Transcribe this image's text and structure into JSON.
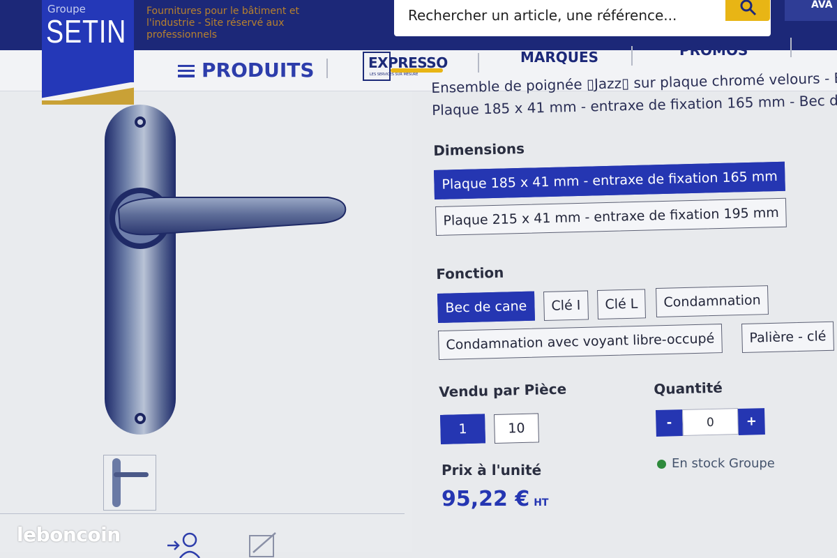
{
  "brand": {
    "group_label": "Groupe",
    "name": "SETIN",
    "tagline": "Fournitures pour le bâtiment et l'industrie - Site réservé aux professionnels"
  },
  "search": {
    "placeholder": "Rechercher un article, une référence...",
    "icon": "magnifier-icon"
  },
  "corner_link": "AVA",
  "nav": {
    "produits": "PRODUITS",
    "expresso": "EXPRESSO",
    "expresso_sub": "LES SERVICES SUR MESURE",
    "marques": "MARQUES",
    "promos": "PROMOS"
  },
  "product": {
    "description_line1": "Ensemble de poignée ▯Jazz▯ sur plaque chromé velours - B",
    "description_line2": "Plaque 185 x 41 mm - entraxe de fixation 165 mm - Bec de"
  },
  "dimensions": {
    "label": "Dimensions",
    "options": [
      {
        "label": "Plaque 185 x 41 mm - entraxe de fixation 165 mm",
        "selected": true
      },
      {
        "label": "Plaque 215 x 41 mm - entraxe de fixation 195 mm",
        "selected": false
      }
    ]
  },
  "fonction": {
    "label": "Fonction",
    "options": [
      {
        "label": "Bec de cane",
        "selected": true
      },
      {
        "label": "Clé I",
        "selected": false
      },
      {
        "label": "Clé L",
        "selected": false
      },
      {
        "label": "Condamnation",
        "selected": false
      },
      {
        "label": "Condamnation avec voyant libre-occupé",
        "selected": false
      },
      {
        "label": "Palière - clé",
        "selected": false
      }
    ]
  },
  "vendu": {
    "label": "Vendu par Pièce",
    "options": [
      {
        "label": "1",
        "selected": true
      },
      {
        "label": "10",
        "selected": false
      }
    ]
  },
  "quantite": {
    "label": "Quantité",
    "minus": "-",
    "value": "0",
    "plus": "+"
  },
  "stock": {
    "text": "En stock Groupe",
    "status_color": "#2e8a3c"
  },
  "prix": {
    "label": "Prix à l'unité",
    "value": "95,22 €",
    "suffix": "HT"
  },
  "watermark": "leboncoin",
  "colors": {
    "primary": "#2536b2",
    "header": "#1c2878",
    "accent": "#e8b515"
  }
}
